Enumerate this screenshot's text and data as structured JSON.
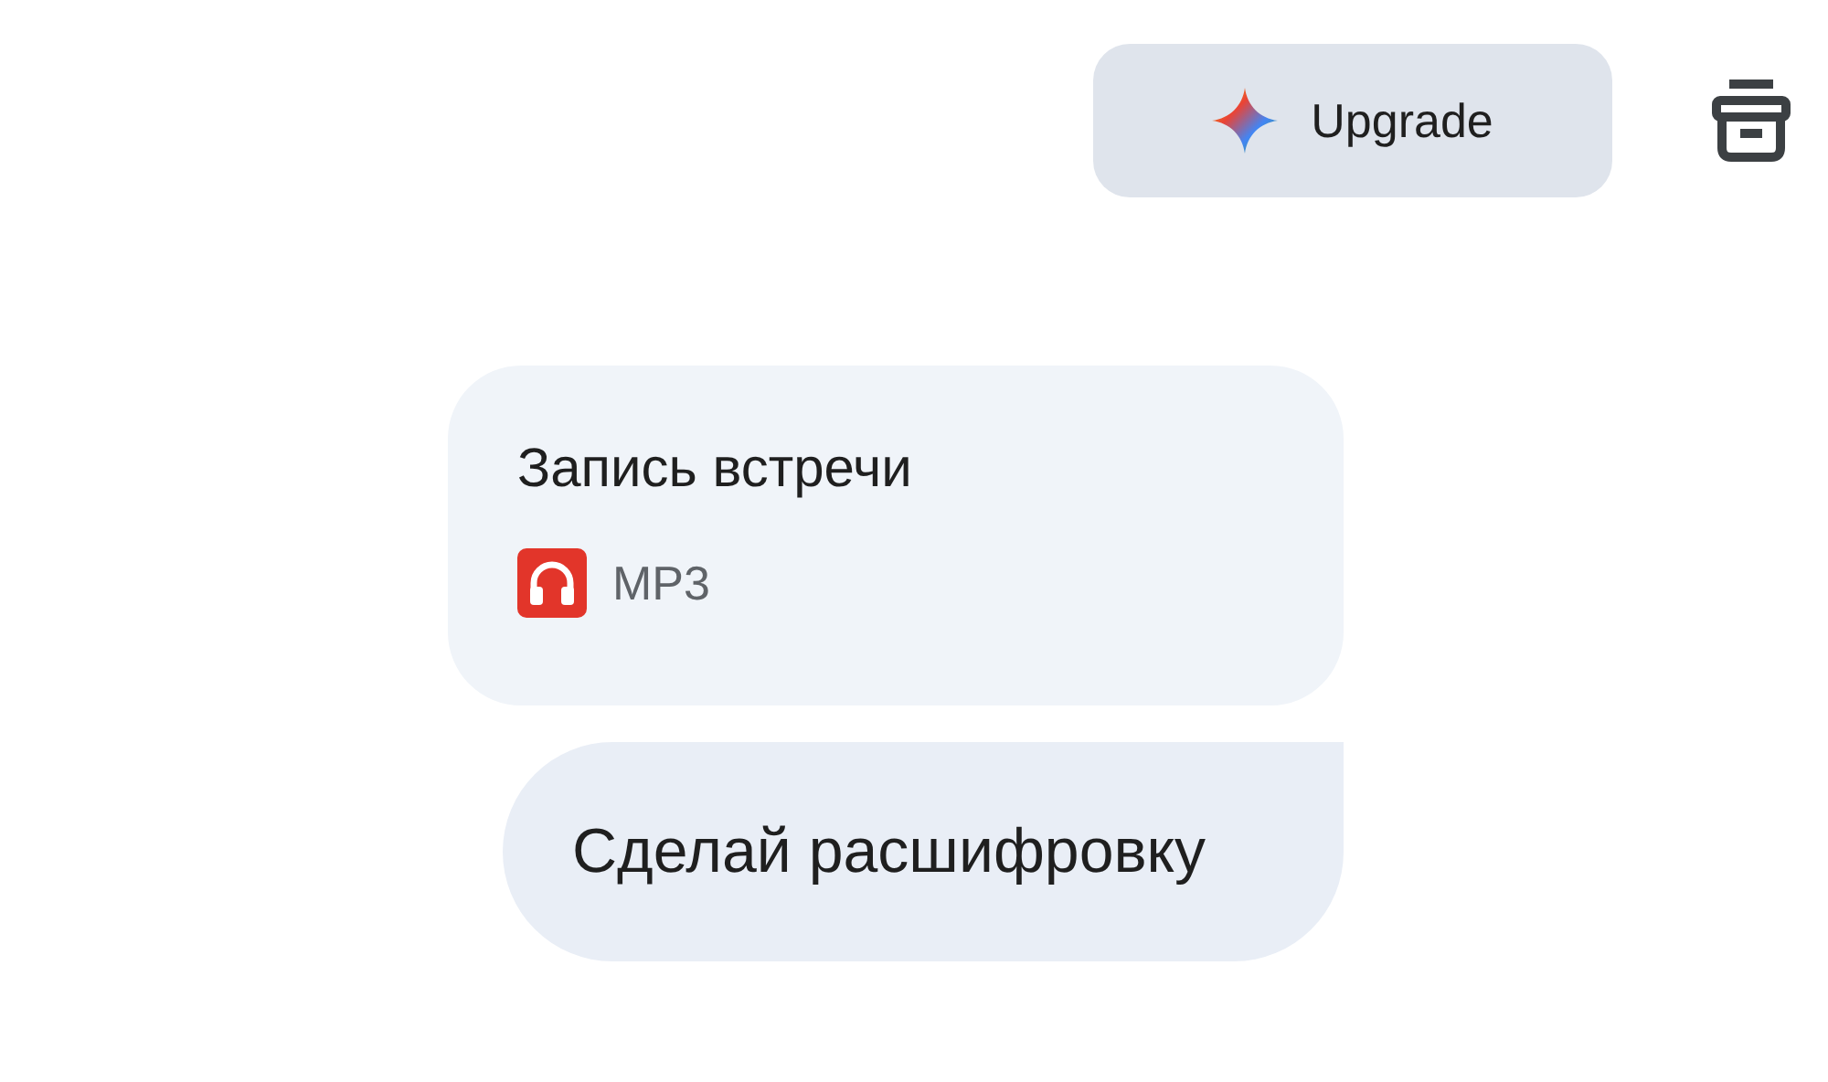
{
  "header": {
    "upgrade_button": {
      "label": "Upgrade"
    }
  },
  "file_card": {
    "title": "Запись встречи",
    "file_type": "MP3"
  },
  "message": {
    "text": "Сделай расшифровку"
  }
}
